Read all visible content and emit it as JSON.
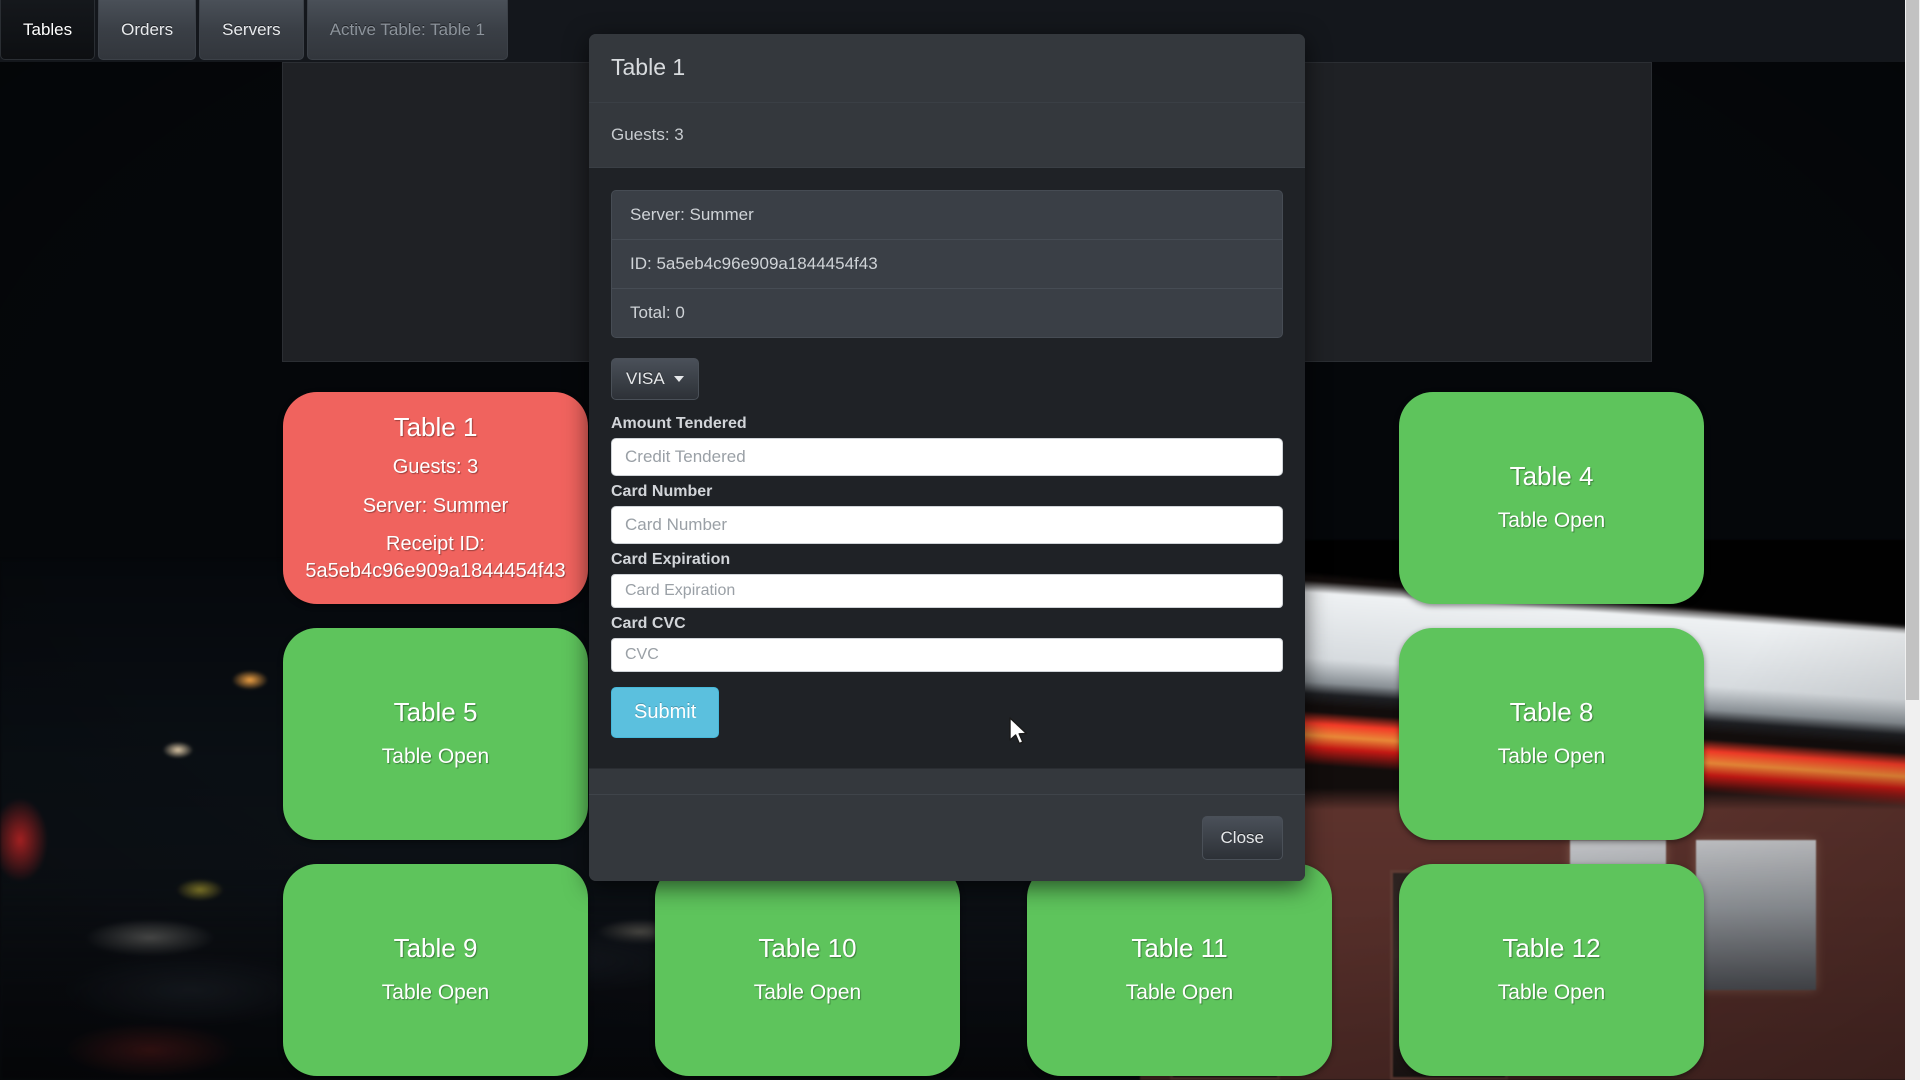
{
  "nav": {
    "tabs": [
      {
        "label": "Tables",
        "state": "active"
      },
      {
        "label": "Orders",
        "state": "normal"
      },
      {
        "label": "Servers",
        "state": "normal"
      },
      {
        "label": "Active Table: Table 1",
        "state": "muted"
      }
    ]
  },
  "tables": [
    {
      "name": "Table 1",
      "status": "occupied",
      "guests": "Guests: 3",
      "server": "Server: Summer",
      "receipt_label": "Receipt ID:",
      "receipt_id": "5a5eb4c96e909a1844454f43"
    },
    {
      "name": "Table 4",
      "status": "open",
      "state_label": "Table Open"
    },
    {
      "name": "Table 5",
      "status": "open",
      "state_label": "Table Open"
    },
    {
      "name": "Table 8",
      "status": "open",
      "state_label": "Table Open"
    },
    {
      "name": "Table 9",
      "status": "open",
      "state_label": "Table Open"
    },
    {
      "name": "Table 10",
      "status": "open",
      "state_label": "Table Open"
    },
    {
      "name": "Table 11",
      "status": "open",
      "state_label": "Table Open"
    },
    {
      "name": "Table 12",
      "status": "open",
      "state_label": "Table Open"
    }
  ],
  "modal": {
    "title": "Table 1",
    "guests": "Guests: 3",
    "details": [
      "Server: Summer",
      "ID: 5a5eb4c96e909a1844454f43",
      "Total: 0"
    ],
    "payment_type": {
      "selected": "VISA"
    },
    "fields": [
      {
        "label": "Amount Tendered",
        "placeholder": "Credit Tendered",
        "value": "",
        "size": "normal"
      },
      {
        "label": "Card Number",
        "placeholder": "Card Number",
        "value": "",
        "size": "normal"
      },
      {
        "label": "Card Expiration",
        "placeholder": "Card Expiration",
        "value": "",
        "size": "compact"
      },
      {
        "label": "Card CVC",
        "placeholder": "CVC",
        "value": "",
        "size": "compact"
      }
    ],
    "submit_label": "Submit",
    "close_label": "Close"
  },
  "colors": {
    "table_open": "#5ec45c",
    "table_occupied": "#f0635e",
    "submit": "#5bc0de",
    "modal_body": "#1f2226",
    "modal_chrome": "#34383d"
  }
}
